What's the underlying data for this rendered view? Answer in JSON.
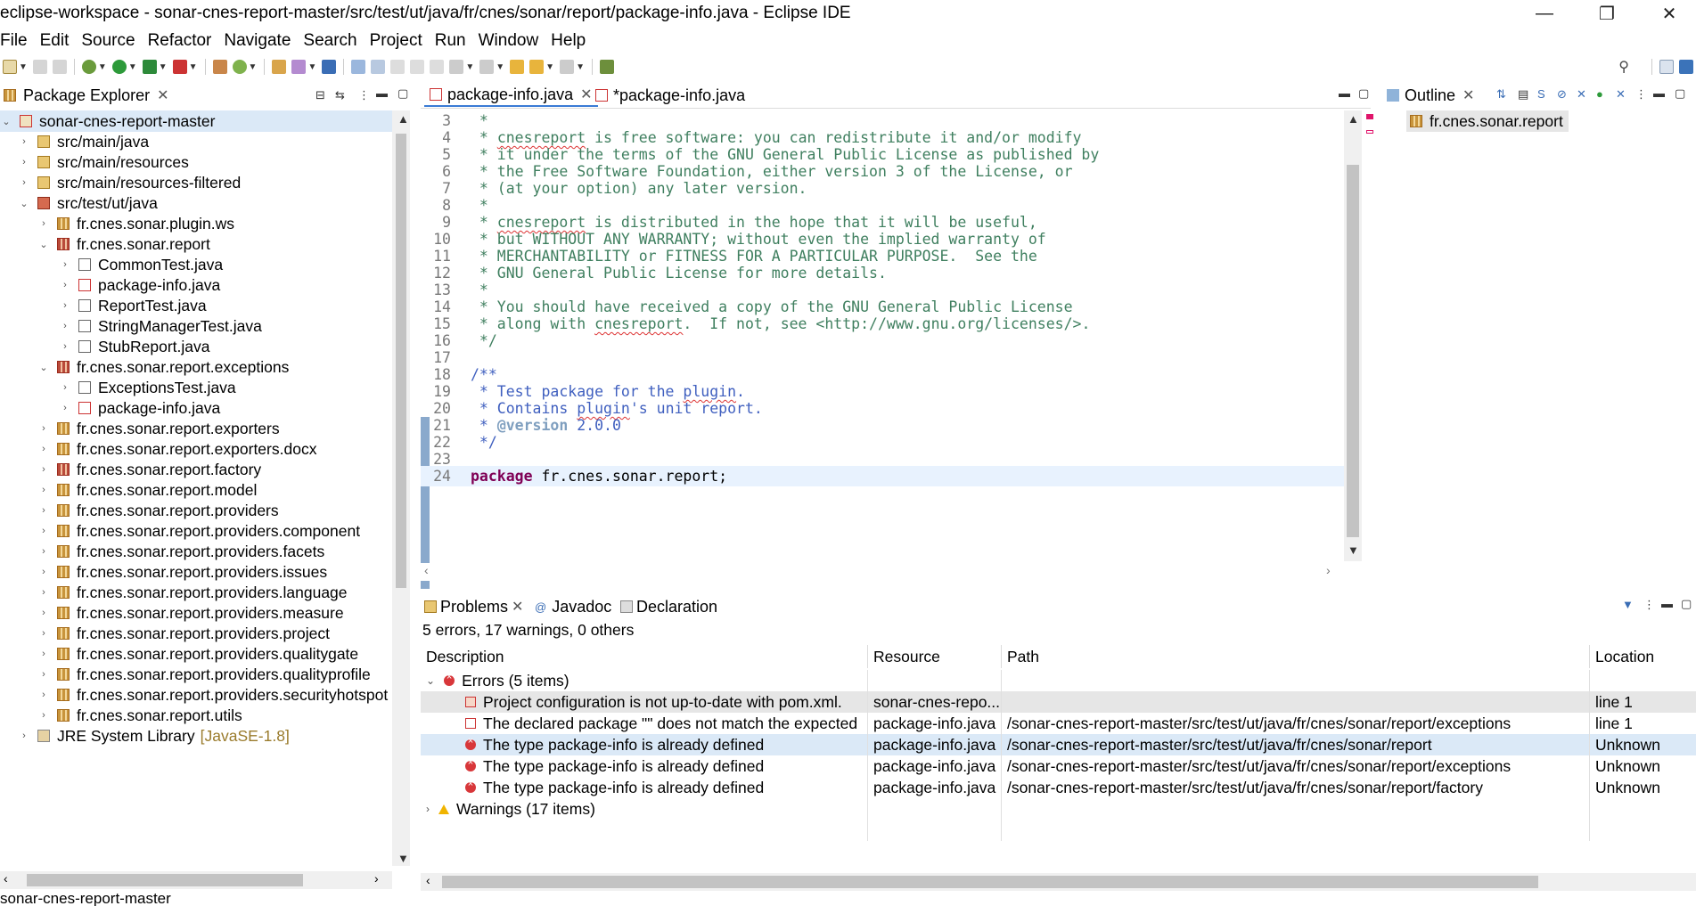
{
  "window": {
    "title": "eclipse-workspace - sonar-cnes-report-master/src/test/ut/java/fr/cnes/sonar/report/package-info.java - Eclipse IDE",
    "minimize": "—",
    "restore": "❐",
    "close": "✕"
  },
  "menu": [
    "File",
    "Edit",
    "Source",
    "Refactor",
    "Navigate",
    "Search",
    "Project",
    "Run",
    "Window",
    "Help"
  ],
  "package_explorer": {
    "title": "Package Explorer",
    "items": [
      {
        "label": "sonar-cnes-report-master",
        "twisty": "⌄",
        "icon": "project-error-icon"
      },
      {
        "label": "src/main/java",
        "twisty": "›",
        "icon": "source-folder-icon"
      },
      {
        "label": "src/main/resources",
        "twisty": "›",
        "icon": "source-folder-icon"
      },
      {
        "label": "src/main/resources-filtered",
        "twisty": "›",
        "icon": "source-folder-icon"
      },
      {
        "label": "src/test/ut/java",
        "twisty": "⌄",
        "icon": "source-folder-error-icon"
      },
      {
        "label": "fr.cnes.sonar.plugin.ws",
        "twisty": "›",
        "icon": "package-icon"
      },
      {
        "label": "fr.cnes.sonar.report",
        "twisty": "⌄",
        "icon": "package-error-icon"
      },
      {
        "label": "CommonTest.java",
        "twisty": "›",
        "icon": "java-file-icon"
      },
      {
        "label": "package-info.java",
        "twisty": "›",
        "icon": "java-file-error-icon"
      },
      {
        "label": "ReportTest.java",
        "twisty": "›",
        "icon": "java-file-icon"
      },
      {
        "label": "StringManagerTest.java",
        "twisty": "›",
        "icon": "java-file-icon"
      },
      {
        "label": "StubReport.java",
        "twisty": "›",
        "icon": "java-file-icon"
      },
      {
        "label": "fr.cnes.sonar.report.exceptions",
        "twisty": "⌄",
        "icon": "package-error-icon"
      },
      {
        "label": "ExceptionsTest.java",
        "twisty": "›",
        "icon": "java-file-icon"
      },
      {
        "label": "package-info.java",
        "twisty": "›",
        "icon": "java-file-error-icon"
      },
      {
        "label": "fr.cnes.sonar.report.exporters",
        "twisty": "›",
        "icon": "package-icon"
      },
      {
        "label": "fr.cnes.sonar.report.exporters.docx",
        "twisty": "›",
        "icon": "package-icon"
      },
      {
        "label": "fr.cnes.sonar.report.factory",
        "twisty": "›",
        "icon": "package-error-icon"
      },
      {
        "label": "fr.cnes.sonar.report.model",
        "twisty": "›",
        "icon": "package-icon"
      },
      {
        "label": "fr.cnes.sonar.report.providers",
        "twisty": "›",
        "icon": "package-icon"
      },
      {
        "label": "fr.cnes.sonar.report.providers.component",
        "twisty": "›",
        "icon": "package-icon"
      },
      {
        "label": "fr.cnes.sonar.report.providers.facets",
        "twisty": "›",
        "icon": "package-icon"
      },
      {
        "label": "fr.cnes.sonar.report.providers.issues",
        "twisty": "›",
        "icon": "package-icon"
      },
      {
        "label": "fr.cnes.sonar.report.providers.language",
        "twisty": "›",
        "icon": "package-icon"
      },
      {
        "label": "fr.cnes.sonar.report.providers.measure",
        "twisty": "›",
        "icon": "package-icon"
      },
      {
        "label": "fr.cnes.sonar.report.providers.project",
        "twisty": "›",
        "icon": "package-icon"
      },
      {
        "label": "fr.cnes.sonar.report.providers.qualitygate",
        "twisty": "›",
        "icon": "package-icon"
      },
      {
        "label": "fr.cnes.sonar.report.providers.qualityprofile",
        "twisty": "›",
        "icon": "package-icon"
      },
      {
        "label": "fr.cnes.sonar.report.providers.securityhotspot",
        "twisty": "›",
        "icon": "package-icon"
      },
      {
        "label": "fr.cnes.sonar.report.utils",
        "twisty": "›",
        "icon": "package-icon"
      },
      {
        "label": "JRE System Library",
        "suffix": "[JavaSE-1.8]",
        "twisty": "›",
        "icon": "library-icon"
      }
    ]
  },
  "editor": {
    "tabs": [
      {
        "label": "package-info.java",
        "active": true,
        "close": "✕"
      },
      {
        "label": "*package-info.java",
        "active": false
      }
    ],
    "lines": [
      {
        "n": "3",
        "kind": "comment",
        "text": " *"
      },
      {
        "n": "4",
        "kind": "comment",
        "text": " * cnesreport is free software: you can redistribute it and/or modify"
      },
      {
        "n": "5",
        "kind": "comment",
        "text": " * it under the terms of the GNU General Public License as published by"
      },
      {
        "n": "6",
        "kind": "comment",
        "text": " * the Free Software Foundation, either version 3 of the License, or"
      },
      {
        "n": "7",
        "kind": "comment",
        "text": " * (at your option) any later version."
      },
      {
        "n": "8",
        "kind": "comment",
        "text": " *"
      },
      {
        "n": "9",
        "kind": "comment",
        "text": " * cnesreport is distributed in the hope that it will be useful,"
      },
      {
        "n": "10",
        "kind": "comment",
        "text": " * but WITHOUT ANY WARRANTY; without even the implied warranty of"
      },
      {
        "n": "11",
        "kind": "comment",
        "text": " * MERCHANTABILITY or FITNESS FOR A PARTICULAR PURPOSE.  See the"
      },
      {
        "n": "12",
        "kind": "comment",
        "text": " * GNU General Public License for more details."
      },
      {
        "n": "13",
        "kind": "comment",
        "text": " *"
      },
      {
        "n": "14",
        "kind": "comment",
        "text": " * You should have received a copy of the GNU General Public License"
      },
      {
        "n": "15",
        "kind": "comment",
        "text": " * along with cnesreport.  If not, see <http://www.gnu.org/licenses/>."
      },
      {
        "n": "16",
        "kind": "comment",
        "text": " */"
      },
      {
        "n": "17",
        "kind": "blank",
        "text": ""
      },
      {
        "n": "18",
        "kind": "doc",
        "text": "/**"
      },
      {
        "n": "19",
        "kind": "doc",
        "text": " * Test package for the plugin."
      },
      {
        "n": "20",
        "kind": "doc",
        "text": " * Contains plugin's unit report."
      },
      {
        "n": "21",
        "kind": "doctag",
        "text": " * @version 2.0.0"
      },
      {
        "n": "22",
        "kind": "doc",
        "text": " */"
      },
      {
        "n": "23",
        "kind": "blank",
        "text": ""
      },
      {
        "n": "24",
        "kind": "code",
        "text": "package fr.cnes.sonar.report;"
      }
    ]
  },
  "outline": {
    "title": "Outline",
    "items": [
      "fr.cnes.sonar.report"
    ]
  },
  "problems": {
    "tabs": [
      "Problems",
      "Javadoc",
      "Declaration"
    ],
    "summary": "5 errors, 17 warnings, 0 others",
    "columns": [
      "Description",
      "Resource",
      "Path",
      "Location"
    ],
    "groups": [
      {
        "label": "Errors (5 items)",
        "rows": [
          {
            "description": "Project configuration is not up-to-date with pom.xml.",
            "resource": "sonar-cnes-repo...",
            "path": "",
            "location": "line 1",
            "icon": "maven-error-icon"
          },
          {
            "description": "The declared package \"\" does not match the expected",
            "resource": "package-info.java",
            "path": "/sonar-cnes-report-master/src/test/ut/java/fr/cnes/sonar/report/exceptions",
            "location": "line 1",
            "icon": "java-error-icon"
          },
          {
            "description": "The type package-info is already defined",
            "resource": "package-info.java",
            "path": "/sonar-cnes-report-master/src/test/ut/java/fr/cnes/sonar/report",
            "location": "Unknown",
            "icon": "error-icon"
          },
          {
            "description": "The type package-info is already defined",
            "resource": "package-info.java",
            "path": "/sonar-cnes-report-master/src/test/ut/java/fr/cnes/sonar/report/exceptions",
            "location": "Unknown",
            "icon": "error-icon"
          },
          {
            "description": "The type package-info is already defined",
            "resource": "package-info.java",
            "path": "/sonar-cnes-report-master/src/test/ut/java/fr/cnes/sonar/report/factory",
            "location": "Unknown",
            "icon": "error-icon"
          }
        ]
      },
      {
        "label": "Warnings (17 items)",
        "rows": []
      }
    ]
  },
  "status_bar": {
    "text": "sonar-cnes-report-master"
  },
  "colors": {
    "selection": "#dbe9f7",
    "comment": "#3f7f5f",
    "javadoc": "#3f5fbf",
    "keyword": "#7f0055",
    "error": "#d8373a",
    "warning": "#f0b400"
  }
}
